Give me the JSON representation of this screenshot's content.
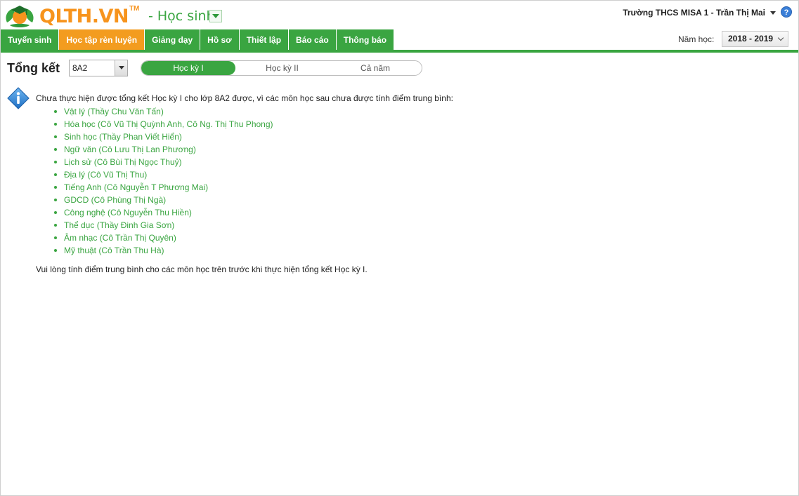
{
  "header": {
    "logo_text": "QLTH.VN",
    "logo_tm": "TM",
    "module_label": "- Học sinh",
    "user_info": "Trường THCS MISA 1 - Trần Thị Mai",
    "help": "?"
  },
  "nav": {
    "items": [
      {
        "label": "Tuyển sinh"
      },
      {
        "label": "Học tập rèn luyện",
        "active": true
      },
      {
        "label": "Giảng dạy"
      },
      {
        "label": "Hồ sơ"
      },
      {
        "label": "Thiết lập"
      },
      {
        "label": "Báo cáo"
      },
      {
        "label": "Thông báo"
      }
    ],
    "school_year_label": "Năm học:",
    "school_year_value": "2018 - 2019"
  },
  "toolbar": {
    "title": "Tổng kết",
    "class_value": "8A2",
    "segments": [
      {
        "label": "Học kỳ I",
        "active": true
      },
      {
        "label": "Học kỳ II"
      },
      {
        "label": "Cả năm"
      }
    ]
  },
  "message": {
    "intro": "Chưa thực hiện được tổng kết Học kỳ I cho lớp 8A2 được, vì các môn học sau chưa được tính điểm trung bình:",
    "subjects": [
      "Vật lý (Thầy Chu Văn Tấn)",
      "Hóa học (Cô Vũ Thị Quỳnh Anh, Cô Ng. Thị Thu Phong)",
      "Sinh học (Thầy Phan Viết Hiển)",
      "Ngữ văn (Cô Lưu Thị Lan Phương)",
      "Lịch sử (Cô Bùi Thị Ngọc Thuỷ)",
      "Địa lý (Cô Vũ Thị Thu)",
      "Tiếng Anh (Cô Nguyễn T Phương Mai)",
      "GDCD (Cô Phùng Thị Ngà)",
      "Công nghệ (Cô Nguyễn Thu Hiền)",
      "Thể dục (Thầy Đinh Gia Sơn)",
      "Âm nhạc (Cô Trần Thị Quyên)",
      "Mỹ thuật (Cô Trần Thu Hà)"
    ],
    "footer": "Vui lòng tính điểm trung bình cho các môn học trên trước khi thực hiện tổng kết Học kỳ I."
  },
  "colors": {
    "brand_green": "#3aa541",
    "brand_orange": "#f39c1f",
    "info_blue": "#2f86d6"
  }
}
